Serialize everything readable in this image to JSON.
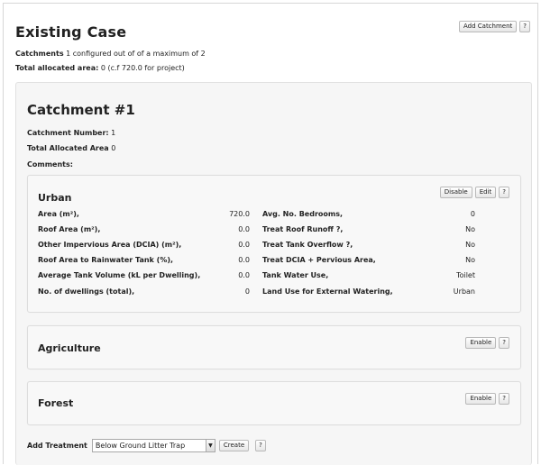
{
  "header": {
    "title": "Existing Case",
    "add_catchment_label": "Add Catchment",
    "help_label": "?"
  },
  "summary": {
    "catchments_label": "Catchments",
    "catchments_text": "1 configured out of of a maximum of 2",
    "total_area_label": "Total allocated area:",
    "total_area_text": "0 (c.f 720.0 for project)"
  },
  "catchment": {
    "title": "Catchment #1",
    "number_label": "Catchment Number:",
    "number_value": "1",
    "allocated_label": "Total Allocated Area",
    "allocated_value": "0",
    "comments_label": "Comments:"
  },
  "urban": {
    "title": "Urban",
    "disable_label": "Disable",
    "edit_label": "Edit",
    "help_label": "?",
    "left": [
      {
        "label": "Area (m²),",
        "value": "720.0"
      },
      {
        "label": "Roof Area (m²),",
        "value": "0.0"
      },
      {
        "label": "Other Impervious Area (DCIA) (m²),",
        "value": "0.0"
      },
      {
        "label": "Roof Area to Rainwater Tank (%),",
        "value": "0.0"
      },
      {
        "label": "Average Tank Volume (kL per Dwelling),",
        "value": "0.0"
      },
      {
        "label": "No. of dwellings (total),",
        "value": "0"
      }
    ],
    "right": [
      {
        "label": "Avg. No. Bedrooms,",
        "value": "0"
      },
      {
        "label": "Treat Roof Runoff ?,",
        "value": "No"
      },
      {
        "label": "Treat Tank Overflow ?,",
        "value": "No"
      },
      {
        "label": "Treat DCIA + Pervious Area,",
        "value": "No"
      },
      {
        "label": "Tank Water Use,",
        "value": "Toilet"
      },
      {
        "label": "Land Use for External Watering,",
        "value": "Urban"
      }
    ]
  },
  "agriculture": {
    "title": "Agriculture",
    "enable_label": "Enable",
    "help_label": "?"
  },
  "forest": {
    "title": "Forest",
    "enable_label": "Enable",
    "help_label": "?"
  },
  "treatment": {
    "label": "Add Treatment",
    "selected": "Below Ground Litter Trap",
    "create_label": "Create",
    "help_label": "?"
  }
}
